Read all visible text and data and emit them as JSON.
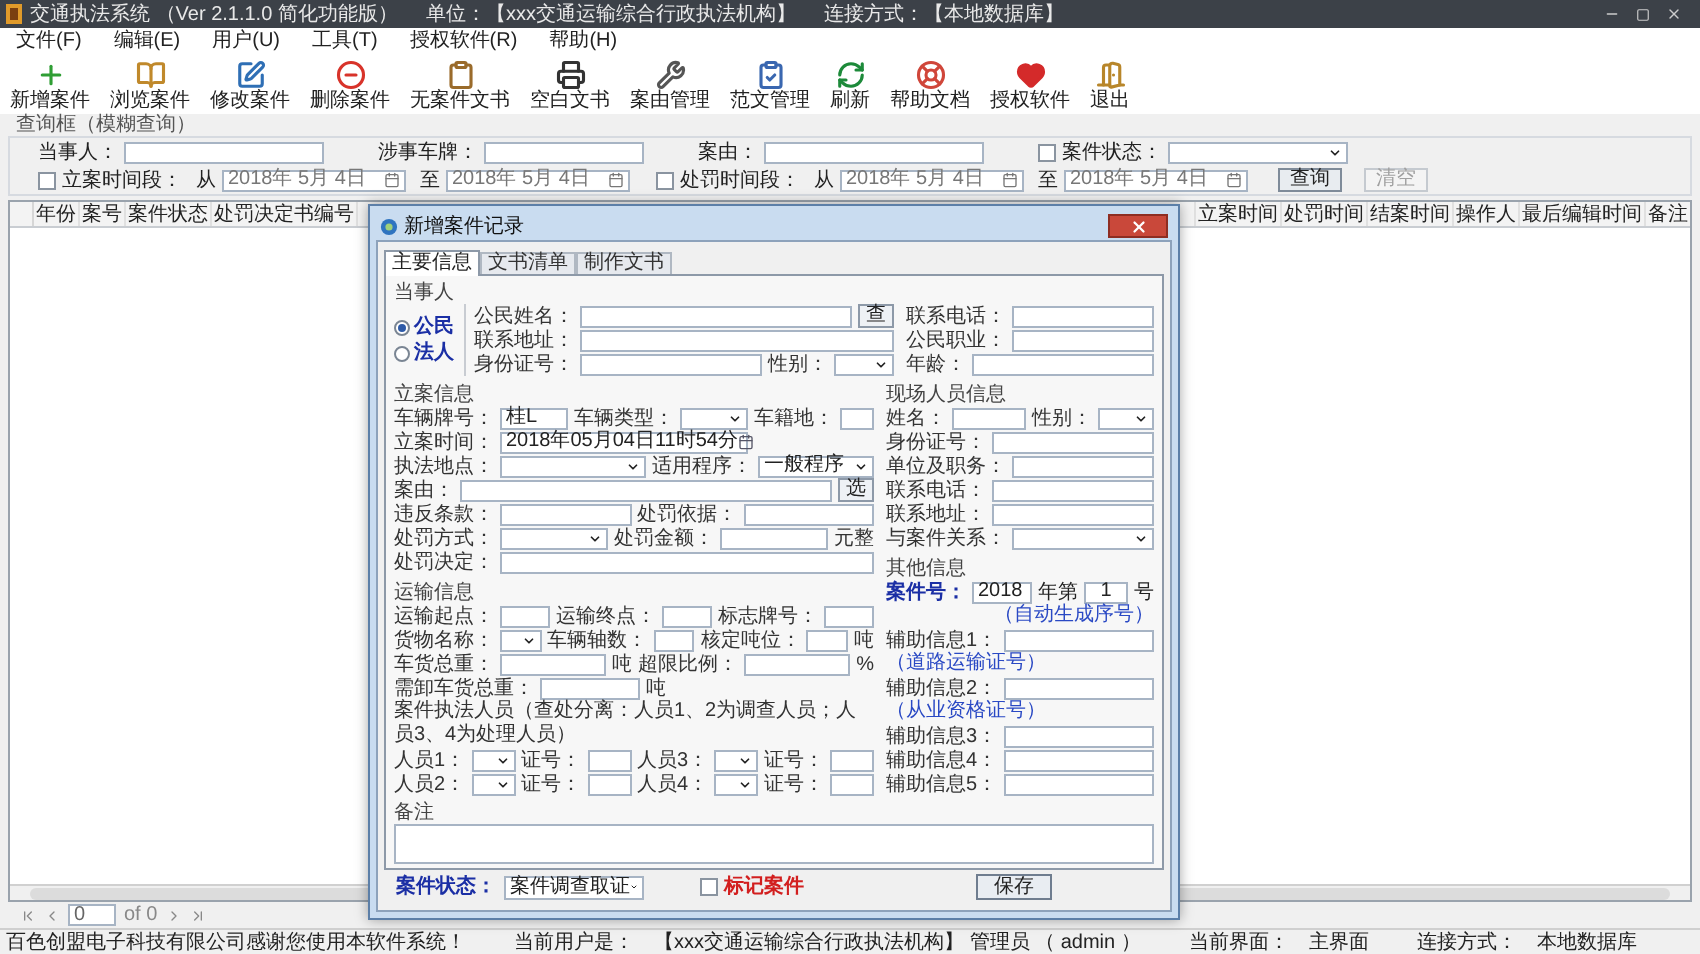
{
  "window": {
    "title": "交通执法系统 （Ver 2.1.1.0 简化功能版）",
    "unit": "单位：【xxx交通运输综合行政执法机构】",
    "connection": "连接方式：【本地数据库】"
  },
  "menu": [
    "文件(F)",
    "编辑(E)",
    "用户(U)",
    "工具(T)",
    "授权软件(R)",
    "帮助(H)"
  ],
  "toolbar": [
    "新增案件",
    "浏览案件",
    "修改案件",
    "删除案件",
    "无案件文书",
    "空白文书",
    "案由管理",
    "范文管理",
    "刷新",
    "帮助文档",
    "授权软件",
    "退出"
  ],
  "query": {
    "title": "查询框（模糊查询）",
    "fields": [
      {
        "label": "当事人："
      },
      {
        "label": "涉事车牌："
      },
      {
        "label": "案由："
      }
    ],
    "status_filter": {
      "label": "案件状态：",
      "checked": false
    },
    "ranges": [
      {
        "label": "立案时间段：",
        "checked": false,
        "from_label": "从",
        "from": "2018年 5月 4日",
        "to_label": "至",
        "to": "2018年 5月 4日"
      },
      {
        "label": "处罚时间段：",
        "checked": false,
        "from_label": "从",
        "from": "2018年 5月 4日",
        "to_label": "至",
        "to": "2018年 5月 4日"
      }
    ],
    "buttons": [
      {
        "label": "查询",
        "disabled": false
      },
      {
        "label": "清空",
        "disabled": true
      }
    ]
  },
  "table": {
    "columns_left": [
      "年份",
      "案号",
      "案件状态",
      "处罚决定书编号"
    ],
    "columns_right": [
      "立案时间",
      "处罚时间",
      "结案时间",
      "操作人",
      "最后编辑时间",
      "备注"
    ]
  },
  "pager": {
    "page": "0",
    "total": "of 0"
  },
  "status_bar": [
    "百色创盟电子科技有限公司感谢您使用本软件系统！",
    "当前用户是：",
    "【xxx交通运输综合行政执法机构】 管理员 （ admin ）",
    "当前界面：",
    "主界面",
    "连接方式：",
    "本地数据库"
  ],
  "dialog": {
    "title": "新增案件记录",
    "tabs": [
      {
        "label": "主要信息",
        "selected": true
      },
      {
        "label": "文书清单",
        "selected": false
      },
      {
        "label": "制作文书",
        "selected": false
      }
    ],
    "party": {
      "title": "当事人",
      "types": [
        {
          "label": "公民",
          "selected": true
        },
        {
          "label": "法人",
          "selected": false
        }
      ],
      "fields": [
        {
          "label": "公民姓名：",
          "kind": "input",
          "button": "查"
        },
        {
          "label": "联系地址：",
          "kind": "input"
        },
        {
          "label": "身份证号：",
          "kind": "input"
        },
        {
          "label": "性别：",
          "kind": "select"
        }
      ],
      "contact": [
        {
          "label": "联系电话：",
          "kind": "input"
        },
        {
          "label": "公民职业：",
          "kind": "input"
        },
        {
          "label": "年龄：",
          "kind": "input"
        }
      ]
    },
    "filing": {
      "title": "立案信息",
      "fields": [
        {
          "label": "车辆牌号：",
          "kind": "input",
          "value": "桂L"
        },
        {
          "label": "车辆类型：",
          "kind": "select"
        },
        {
          "label": "车籍地：",
          "kind": "input"
        },
        {
          "label": "立案时间：",
          "kind": "date",
          "value": "2018年05月04日11时54分"
        },
        {
          "label": "执法地点：",
          "kind": "select"
        },
        {
          "label": "适用程序：",
          "kind": "select",
          "value": "一般程序"
        },
        {
          "label": "案由：",
          "kind": "input",
          "button": "选"
        },
        {
          "label": "违反条款：",
          "kind": "input"
        },
        {
          "label": "处罚依据：",
          "kind": "input"
        },
        {
          "label": "处罚方式：",
          "kind": "select"
        },
        {
          "label": "处罚金额：",
          "kind": "input",
          "unit": "元整"
        },
        {
          "label": "处罚决定：",
          "kind": "input"
        }
      ]
    },
    "witness": {
      "title": "现场人员信息",
      "fields": [
        {
          "label": "姓名：",
          "kind": "input"
        },
        {
          "label": "性别：",
          "kind": "select"
        },
        {
          "label": "身份证号：",
          "kind": "input"
        },
        {
          "label": "单位及职务：",
          "kind": "input"
        },
        {
          "label": "联系电话：",
          "kind": "input"
        },
        {
          "label": "联系地址：",
          "kind": "input"
        },
        {
          "label": "与案件关系：",
          "kind": "select"
        }
      ]
    },
    "transport": {
      "title": "运输信息",
      "fields": [
        {
          "label": "运输起点：",
          "kind": "input"
        },
        {
          "label": "运输终点：",
          "kind": "input"
        },
        {
          "label": "标志牌号：",
          "kind": "input"
        },
        {
          "label": "货物名称：",
          "kind": "select"
        },
        {
          "label": "车辆轴数：",
          "kind": "input"
        },
        {
          "label": "核定吨位：",
          "kind": "input",
          "unit": "吨"
        },
        {
          "label": "车货总重：",
          "kind": "input",
          "unit": "吨"
        },
        {
          "label": "超限比例：",
          "kind": "input",
          "unit": "%"
        },
        {
          "label": "需卸车货总重：",
          "kind": "input",
          "unit": "吨"
        }
      ],
      "staff_note": "案件执法人员（查处分离：人员1、2为调查人员；人员3、4为处理人员）",
      "staff": [
        {
          "label": "人员1：",
          "id_label": "证号："
        },
        {
          "label": "人员3：",
          "id_label": "证号："
        },
        {
          "label": "人员2：",
          "id_label": "证号："
        },
        {
          "label": "人员4：",
          "id_label": "证号："
        }
      ]
    },
    "other": {
      "title": "其他信息",
      "case_no": {
        "label": "案件号：",
        "year": "2018",
        "mid": "年第",
        "number": "1",
        "end": "号",
        "hint": "（自动生成序号）"
      },
      "fields": [
        {
          "label": "辅助信息1：",
          "hint": "（道路运输证号）"
        },
        {
          "label": "辅助信息2：",
          "hint": "（从业资格证号）"
        },
        {
          "label": "辅助信息3："
        },
        {
          "label": "辅助信息4："
        },
        {
          "label": "辅助信息5："
        }
      ]
    },
    "memo": {
      "label": "备注"
    },
    "footer": {
      "status_label": "案件状态：",
      "status": "案件调查取证",
      "flag": {
        "label": "标记案件",
        "checked": false
      },
      "save": "保存"
    }
  }
}
